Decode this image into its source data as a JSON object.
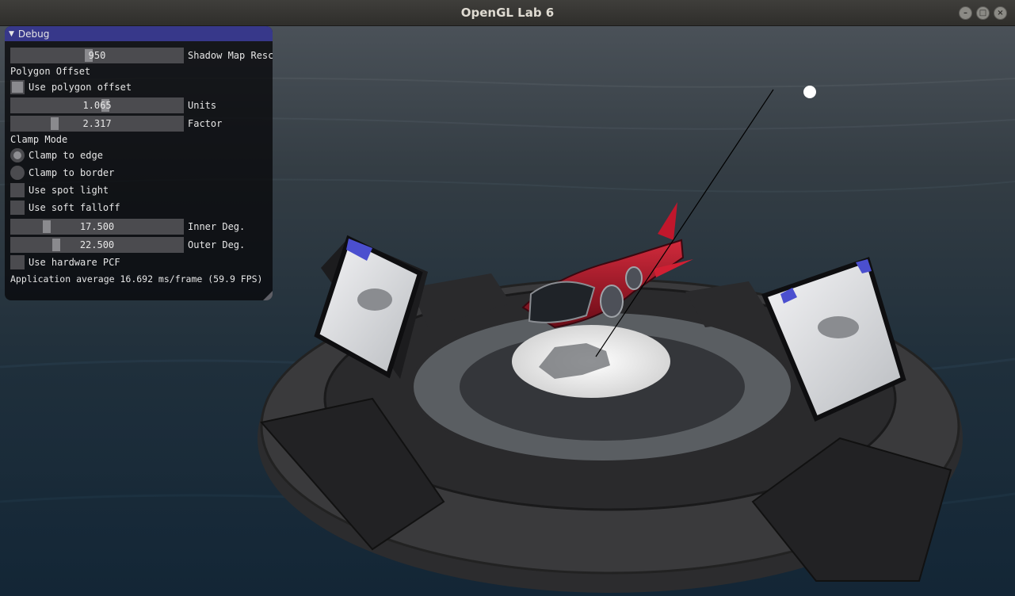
{
  "window": {
    "title": "OpenGL Lab 6"
  },
  "debug": {
    "title": "Debug",
    "shadow_map_res": {
      "value": "950",
      "label": "Shadow Map Resc",
      "fraction": 0.45
    },
    "polygon_offset_header": "Polygon Offset",
    "use_polygon_offset": {
      "label": "Use polygon offset",
      "checked": true
    },
    "units": {
      "value": "1.065",
      "label": "Units",
      "fraction": 0.55
    },
    "factor": {
      "value": "2.317",
      "label": "Factor",
      "fraction": 0.24
    },
    "clamp_mode_header": "Clamp Mode",
    "clamp_to_edge": {
      "label": "Clamp to edge",
      "selected": true
    },
    "clamp_to_border": {
      "label": "Clamp to border",
      "selected": false
    },
    "use_spot_light": {
      "label": "Use spot light",
      "checked": false
    },
    "use_soft_falloff": {
      "label": "Use soft falloff",
      "checked": false
    },
    "inner_deg": {
      "value": "17.500",
      "label": "Inner Deg.",
      "fraction": 0.19
    },
    "outer_deg": {
      "value": "22.500",
      "label": "Outer Deg.",
      "fraction": 0.25
    },
    "use_hardware_pcf": {
      "label": "Use hardware PCF",
      "checked": false
    },
    "fps_text": "Application average 16.692 ms/frame (59.9 FPS)"
  },
  "colors": {
    "header": "#37388a",
    "ship_red": "#b0142a",
    "ocean": "#1d3040"
  }
}
